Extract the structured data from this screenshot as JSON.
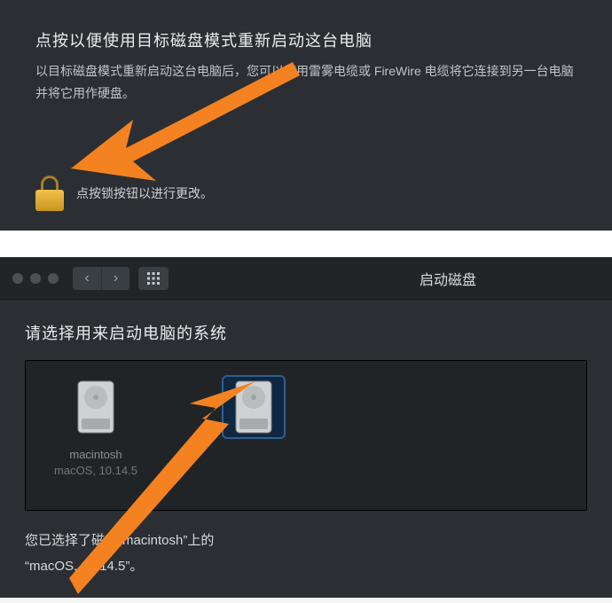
{
  "top": {
    "title": "点按以便使用目标磁盘模式重新启动这台电脑",
    "description": "以目标磁盘模式重新启动这台电脑后，您可以使用雷雾电缆或 FireWire 电缆将它连接到另一台电脑并将它用作硬盘。",
    "lock_text": "点按锁按钮以进行更改。"
  },
  "bottom": {
    "window_title": "启动磁盘",
    "instruction": "请选择用来启动电脑的系统",
    "disks": [
      {
        "name": "macintosh",
        "sub": "macOS, 10.14.5",
        "selected": false
      },
      {
        "name": "",
        "sub": "",
        "selected": true
      }
    ],
    "status_line1": "您已选择了磁盘“macintosh”上的",
    "status_line2": "“macOS, 10.14.5”。"
  }
}
